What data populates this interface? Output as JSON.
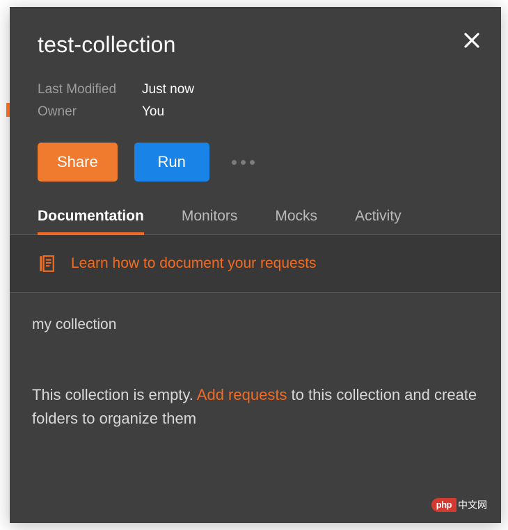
{
  "colors": {
    "accent": "#f26b21",
    "primary_button": "#f07a2e",
    "secondary_button": "#1a83e8",
    "panel_bg": "#3f3f3f"
  },
  "header": {
    "title": "test-collection"
  },
  "meta": {
    "last_modified_label": "Last Modified",
    "last_modified_value": "Just now",
    "owner_label": "Owner",
    "owner_value": "You"
  },
  "actions": {
    "share_label": "Share",
    "run_label": "Run"
  },
  "tabs": [
    {
      "label": "Documentation",
      "active": true
    },
    {
      "label": "Monitors",
      "active": false
    },
    {
      "label": "Mocks",
      "active": false
    },
    {
      "label": "Activity",
      "active": false
    }
  ],
  "learn_banner": {
    "text": "Learn how to document your requests"
  },
  "documentation": {
    "collection_name": "my collection",
    "empty_prefix": "This collection is empty. ",
    "empty_link": "Add requests",
    "empty_suffix": " to this collection and create folders to organize them"
  },
  "watermark": {
    "badge": "php",
    "text": "中文网"
  }
}
